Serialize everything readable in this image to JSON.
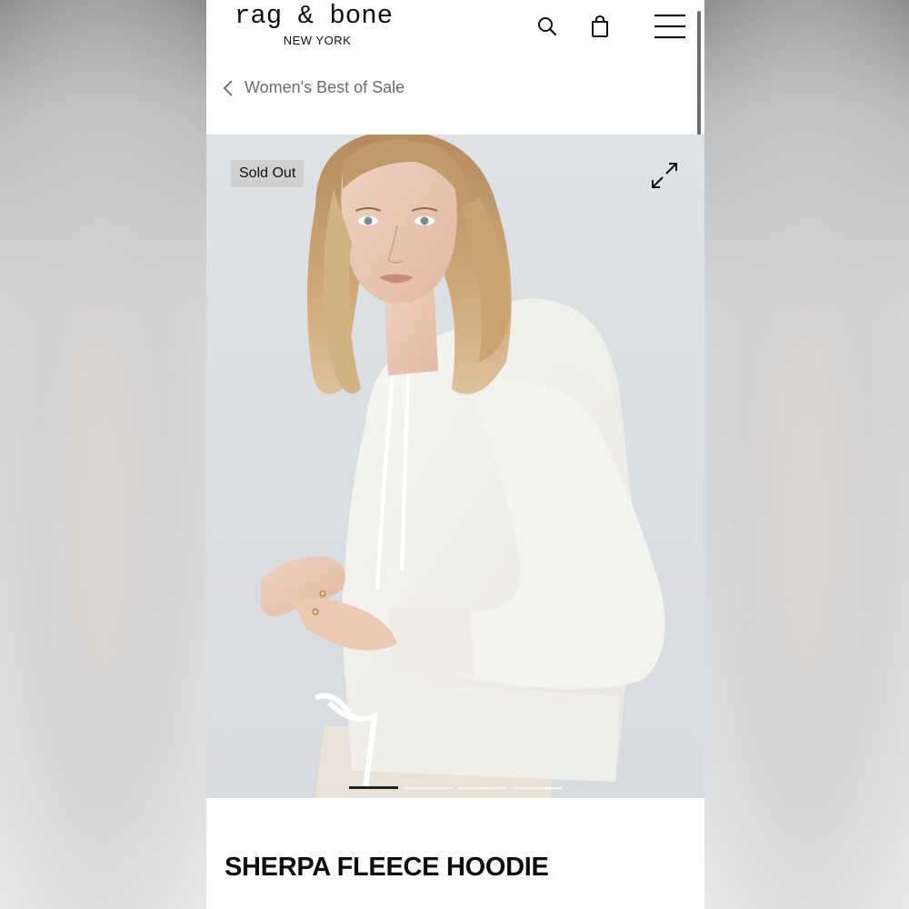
{
  "header": {
    "brand": "rag & bone",
    "brand_sub": "NEW YORK",
    "icons": [
      "search-icon",
      "shopping-bag-icon",
      "hamburger-menu-icon"
    ]
  },
  "breadcrumb": {
    "label": "Women's Best of Sale",
    "icon": "chevron-left-icon"
  },
  "hero": {
    "badge": "Sold Out",
    "expand_icon": "expand-icon",
    "carousel": {
      "total": 4,
      "active": 1
    }
  },
  "product": {
    "title": "SHERPA FLEECE HOODIE"
  },
  "colors": {
    "text_primary": "#111111",
    "text_muted": "#6b6b6b",
    "badge_bg": "#d0d0d0",
    "hero_bg": "#dcdfe2",
    "sweater": "#f2f0ec"
  }
}
